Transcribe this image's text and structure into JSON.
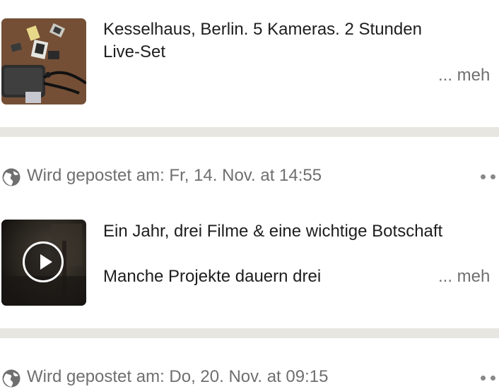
{
  "posts": [
    {
      "caption_line1": "Kesselhaus, Berlin. 5 Kameras. 2 Stunden",
      "caption_line2": "Live-Set",
      "more_label": "... meh",
      "thumbnail_icon": "photo-sd-cards"
    },
    {
      "scheduled_text": "Wird gepostet am: Fr, 14. Nov. at 14:55",
      "globe_icon": "globe-icon",
      "menu_icon": "more-dots-icon",
      "caption_line1": "Ein Jahr, drei Filme & eine wichtige Botschaft",
      "caption_line2": "Manche Projekte dauern drei",
      "more_label": "... meh",
      "thumbnail_icon": "video-play-icon"
    },
    {
      "scheduled_text": "Wird gepostet am: Do, 20. Nov. at 09:15",
      "globe_icon": "globe-icon",
      "menu_icon": "more-dots-icon"
    }
  ],
  "colors": {
    "separator": "#e8e6e0",
    "muted_text": "#6f6f6f",
    "primary_text": "#1e1e1e"
  }
}
